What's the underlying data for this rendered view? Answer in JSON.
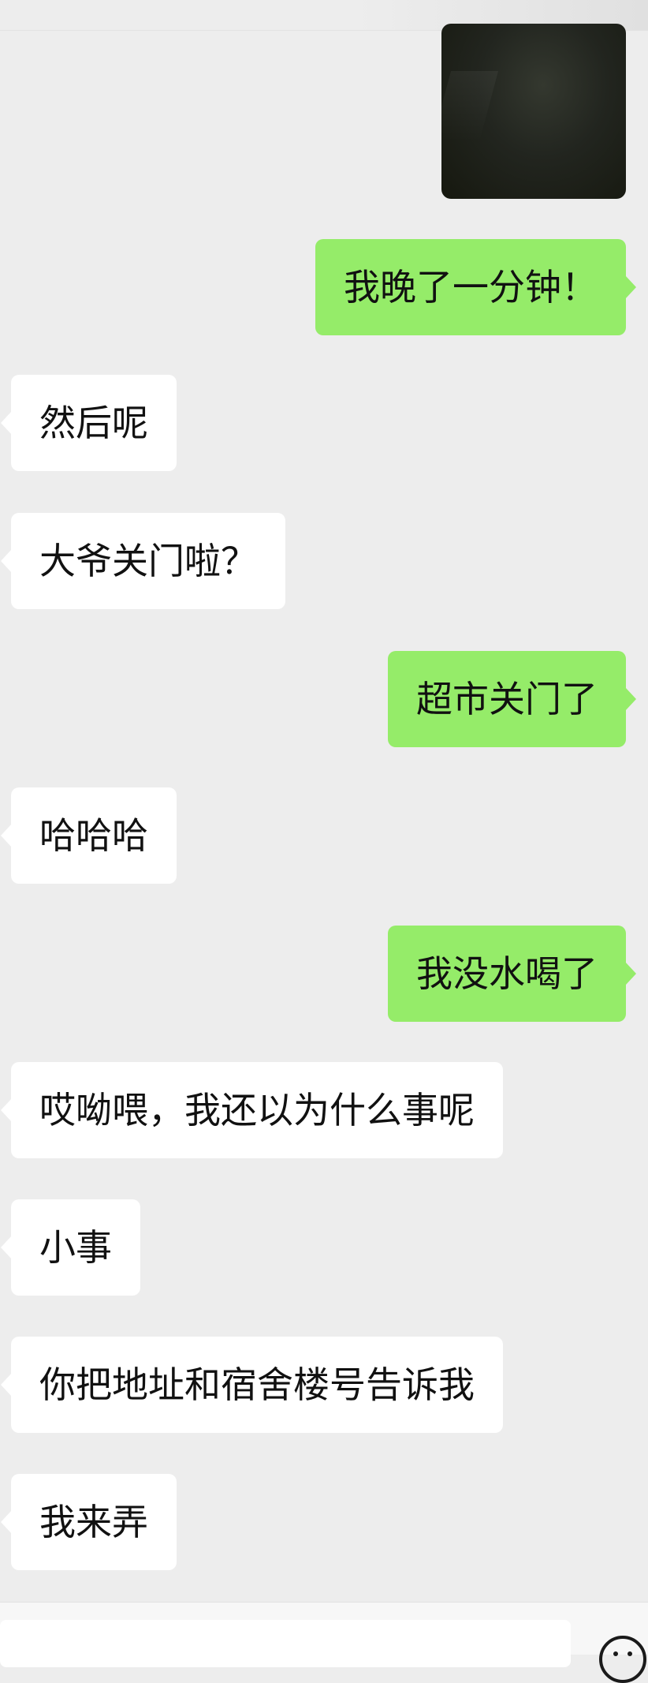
{
  "messages": [
    {
      "side": "out",
      "text": "我晚了一分钟！"
    },
    {
      "side": "in",
      "text": "然后呢"
    },
    {
      "side": "in",
      "text": "大爷关门啦？"
    },
    {
      "side": "out",
      "text": "超市关门了"
    },
    {
      "side": "in",
      "text": "哈哈哈"
    },
    {
      "side": "out",
      "text": "我没水喝了"
    },
    {
      "side": "in",
      "text": "哎呦喂，我还以为什么事呢"
    },
    {
      "side": "in",
      "text": "小事"
    },
    {
      "side": "in",
      "text": "你把地址和宿舍楼号告诉我"
    },
    {
      "side": "in",
      "text": "我来弄"
    }
  ],
  "colors": {
    "background": "#ededed",
    "incoming_bubble": "#ffffff",
    "outgoing_bubble": "#95ec69"
  },
  "icons": {
    "emoji": "smiley-face-icon"
  }
}
